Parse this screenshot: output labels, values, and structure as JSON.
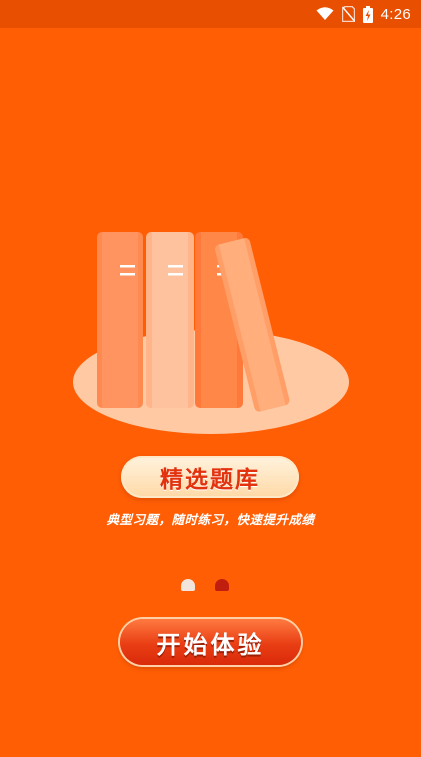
{
  "status_bar": {
    "time": "4:26",
    "icons": [
      "wifi-icon",
      "no-sim-icon",
      "battery-charging-icon"
    ]
  },
  "hero": {
    "illustration": "books-on-plate-illustration",
    "title": "精选题库",
    "subtitle": "典型习题，随时练习，快速提升成绩"
  },
  "pager": {
    "count": 2,
    "active_index": 1
  },
  "actions": {
    "start_label": "开始体验"
  },
  "colors": {
    "background": "#FF5E05",
    "status_bar": "#E84F00",
    "title_text": "#E2320E",
    "active_dot": "#C01F10",
    "inactive_dot": "#F2E6DC"
  }
}
